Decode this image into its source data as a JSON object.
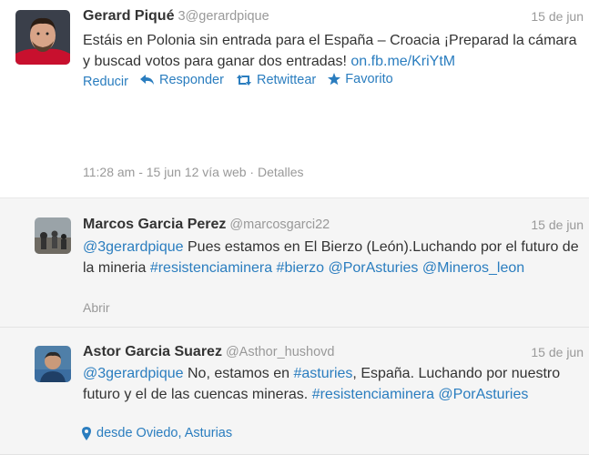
{
  "main_tweet": {
    "fullname": "Gerard Piqué",
    "username": "3@gerardpique",
    "date": "15 de jun",
    "text_plain": "Estáis en Polonia sin entrada para el España – Croacia ¡Preparad la cámara y buscad votos para ganar dos entradas! ",
    "text_link": "on.fb.me/KriYtM",
    "actions": {
      "reduce": "Reducir",
      "reply": "Responder",
      "retweet": "Retwittear",
      "favorite": "Favorito"
    },
    "meta": "11:28 am - 15 jun 12 vía web · Detalles"
  },
  "replies": [
    {
      "fullname": "Marcos Garcia Perez",
      "username": "@marcosgarci22",
      "date": "15 de jun",
      "mention": "@3gerardpique",
      "text_1": " Pues estamos en El Bierzo (León).Luchando por el futuro de la mineria ",
      "hashtag_1": "#resistenciaminera",
      "hashtag_2": "#bierzo",
      "mention_2": "@PorAsturies",
      "mention_3": "@Mineros_leon",
      "expand": "Abrir"
    },
    {
      "fullname": "Astor Garcia Suarez",
      "username": "@Asthor_hushovd",
      "date": "15 de jun",
      "mention": "@3gerardpique",
      "text_1": " No, estamos en ",
      "hashtag_1": "#asturies",
      "text_2": ", España. Luchando por nuestro futuro y el de las cuencas mineras. ",
      "hashtag_2": "#resistenciaminera",
      "mention_2": "@PorAsturies",
      "place": "desde Oviedo, Asturias"
    }
  ],
  "colors": {
    "link": "#2a7dbf",
    "muted": "#999999",
    "text": "#333333",
    "reply_bg": "#f5f5f5"
  }
}
